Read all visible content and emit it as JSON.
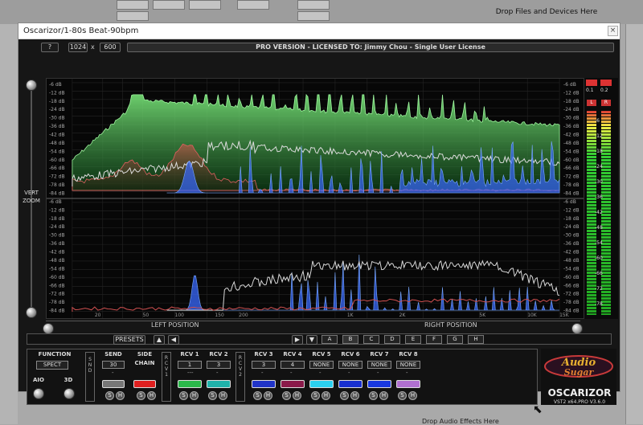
{
  "host": {
    "drop_files": "Drop Files and Devices Here",
    "drop_effects": "Drop Audio Effects Here"
  },
  "window": {
    "title": "Oscarizor/1-80s Beat-90bpm",
    "close": "×"
  },
  "toolbar": {
    "help": "?",
    "width": "1024",
    "x": "x",
    "height": "600",
    "license": "PRO VERSION - LICENSED TO: Jimmy Chou - Single User License"
  },
  "vert_zoom": "VERT\nZOOM",
  "spectrum": {
    "db_labels_top": [
      "-6 dB",
      "-12 dB",
      "-18 dB",
      "-24 dB",
      "-30 dB",
      "-36 dB",
      "-42 dB",
      "-48 dB",
      "-54 dB",
      "-60 dB",
      "-66 dB",
      "-72 dB",
      "-78 dB",
      "-84 dB"
    ],
    "db_labels_bottom": [
      "-6 dB",
      "-12 dB",
      "-18 dB",
      "-24 dB",
      "-30 dB",
      "-36 dB",
      "-42 dB",
      "-48 dB",
      "-54 dB",
      "-60 dB",
      "-66 dB",
      "-72 dB",
      "-78 dB",
      "-84 dB"
    ],
    "freq_labels": [
      "20",
      "50",
      "100",
      "150",
      "200",
      "1K",
      "2K",
      "5K",
      "10K",
      "15K"
    ]
  },
  "meters": {
    "peak_l": "0.1",
    "peak_r": "0.2",
    "l": "L",
    "r": "R",
    "scale": [
      "-6",
      "-12",
      "-18",
      "-24",
      "-30",
      "-36",
      "-42",
      "-48",
      "-54",
      "-60",
      "-66",
      "-72",
      "-78"
    ]
  },
  "positions": {
    "left": "LEFT POSITION",
    "right": "RIGHT POSITION"
  },
  "presets": {
    "label": "PRESETS",
    "slots": [
      "A",
      "B",
      "C",
      "D",
      "E",
      "F",
      "G",
      "H"
    ],
    "active": [
      "B"
    ]
  },
  "routing": {
    "function": "FUNCTION",
    "spect": "SPECT",
    "aio": "AIO",
    "three_d": "3D",
    "send": "SEND",
    "send_val": "30",
    "send_sub": "-",
    "side": "SIDE",
    "chain": "CHAIN",
    "snd": "S\nN\nD",
    "rcv1_v": "R\nC\nV\n1",
    "rcv2_v": "R\nC\nV\n2",
    "receivers": [
      {
        "label": "RCV 1",
        "value": "1",
        "sub": "---",
        "color": "#2bb84a"
      },
      {
        "label": "RCV 2",
        "value": "3",
        "sub": "-",
        "color": "#20b2aa"
      },
      {
        "label": "RCV 3",
        "value": "3",
        "sub": "-",
        "color": "#2034c8"
      },
      {
        "label": "RCV 4",
        "value": "4",
        "sub": "-",
        "color": "#8a1a4a"
      },
      {
        "label": "RCV 5",
        "value": "NONE",
        "sub": "-",
        "color": "#2bd0f0"
      },
      {
        "label": "RCV 6",
        "value": "NONE",
        "sub": "-",
        "color": "#1830d0"
      },
      {
        "label": "RCV 7",
        "value": "NONE",
        "sub": "-",
        "color": "#1838e0"
      },
      {
        "label": "RCV 8",
        "value": "NONE",
        "sub": "-",
        "color": "#b070d0"
      }
    ],
    "s": "S",
    "h": "H"
  },
  "brand": {
    "logo": "Audio Sugar",
    "name": "OSCARIZOR",
    "version": "VST2 x64.PRO V3.6.0"
  }
}
